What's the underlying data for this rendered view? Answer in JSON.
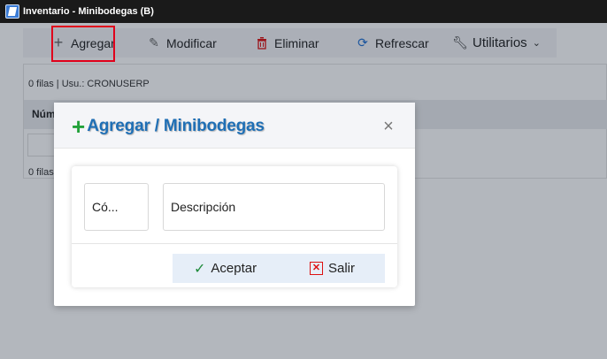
{
  "window": {
    "title": "Inventario - Minibodegas (B)"
  },
  "toolbar": {
    "agregar": "Agregar",
    "modificar": "Modificar",
    "eliminar": "Eliminar",
    "refrescar": "Refrescar",
    "utilitarios": "Utilitarios"
  },
  "grid": {
    "status": "0 filas | Usu.: CRONUSERP",
    "header_first_col": "Núm",
    "footer": "0 filas"
  },
  "modal": {
    "title": "Agregar / Minibodegas",
    "fields": {
      "codigo_placeholder": "Có...",
      "descripcion_placeholder": "Descripción"
    },
    "buttons": {
      "aceptar": "Aceptar",
      "salir": "Salir"
    }
  },
  "colors": {
    "accent_blue": "#1f6fb5",
    "add_green": "#22a13a",
    "delete_red": "#d11111",
    "highlight_red": "#e0001b"
  }
}
